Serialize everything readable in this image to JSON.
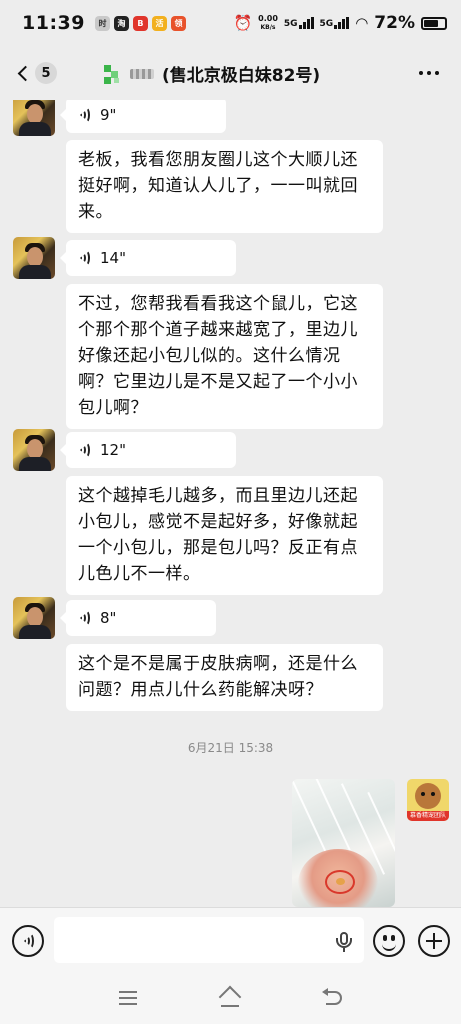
{
  "status_bar": {
    "time": "11:39",
    "apps": [
      {
        "label": "时",
        "color": "#c9c9c9",
        "icon": "clock-app-icon"
      },
      {
        "label": "淘",
        "color": "#222222",
        "icon": "taobao-icon"
      },
      {
        "label": "B",
        "color": "#e0352b",
        "icon": "red-app-icon"
      },
      {
        "label": "活",
        "color": "#f2b01e",
        "icon": "yellow-app-icon"
      },
      {
        "label": "领",
        "color": "#e8522b",
        "icon": "orange-app-icon"
      }
    ],
    "net_speed_value": "0.00",
    "net_speed_unit": "KB/s",
    "signal_1": "5G",
    "signal_2": "5G",
    "battery": "72%",
    "battery_level": 0.72
  },
  "nav": {
    "unread_count": "5",
    "title": "(售北京极白妹82号)"
  },
  "messages": {
    "voice_1": "9\"",
    "text_1": "老板，我看您朋友圈儿这个大顺儿还挺好啊，知道认人儿了，一一叫就回来。",
    "voice_2": "14\"",
    "text_2": "不过，您帮我看看我这个鼠儿，它这个那个那个道子越来越宽了，里边儿好像还起小包儿似的。这什么情况啊？它里边儿是不是又起了一个小小包儿啊？",
    "voice_3": "12\"",
    "text_3": "这个越掉毛儿越多，而且里边儿还起小包儿，感觉不是起好多，好像就起一个小包儿，那是包儿吗？反正有点儿色儿不一样。",
    "voice_4": "8\"",
    "text_4": "这个是不是属于皮肤病啊，还是什么问题？用点儿什么药能解决呀？",
    "timestamp": "6月21日 15:38"
  },
  "self_avatar_tag": "慕香精宠团队",
  "colors": {
    "background": "#ededed",
    "bubble": "#ffffff",
    "accent_green": "#3bb54a",
    "highlight_red": "#d9382b"
  }
}
